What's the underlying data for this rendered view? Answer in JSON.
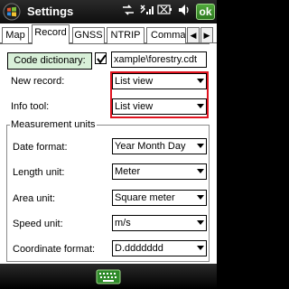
{
  "window": {
    "title": "Settings",
    "ok_label": "ok"
  },
  "status_icons": [
    "connectivity-icon",
    "signal-icon",
    "battery-icon",
    "volume-icon"
  ],
  "tabs": [
    {
      "label": "Map"
    },
    {
      "label": "Record"
    },
    {
      "label": "GNSS"
    },
    {
      "label": "NTRIP"
    },
    {
      "label": "Commar"
    }
  ],
  "active_tab": "Record",
  "record": {
    "code_dictionary_label": "Code dictionary:",
    "code_dictionary_checked": true,
    "code_dictionary_value": "xample\\forestry.cdt",
    "new_record_label": "New record:",
    "new_record_value": "List view",
    "info_tool_label": "Info tool:",
    "info_tool_value": "List view"
  },
  "measurement_units": {
    "title": "Measurement units",
    "date_format_label": "Date format:",
    "date_format_value": "Year Month Day",
    "length_unit_label": "Length unit:",
    "length_unit_value": "Meter",
    "area_unit_label": "Area unit:",
    "area_unit_value": "Square meter",
    "speed_unit_label": "Speed unit:",
    "speed_unit_value": "m/s",
    "coordinate_format_label": "Coordinate format:",
    "coordinate_format_value": "D.ddddddd"
  },
  "colors": {
    "highlight_border": "#e0131f",
    "ok_button": "#3c9a2c",
    "dict_button_bg": "#d8f0d8"
  }
}
